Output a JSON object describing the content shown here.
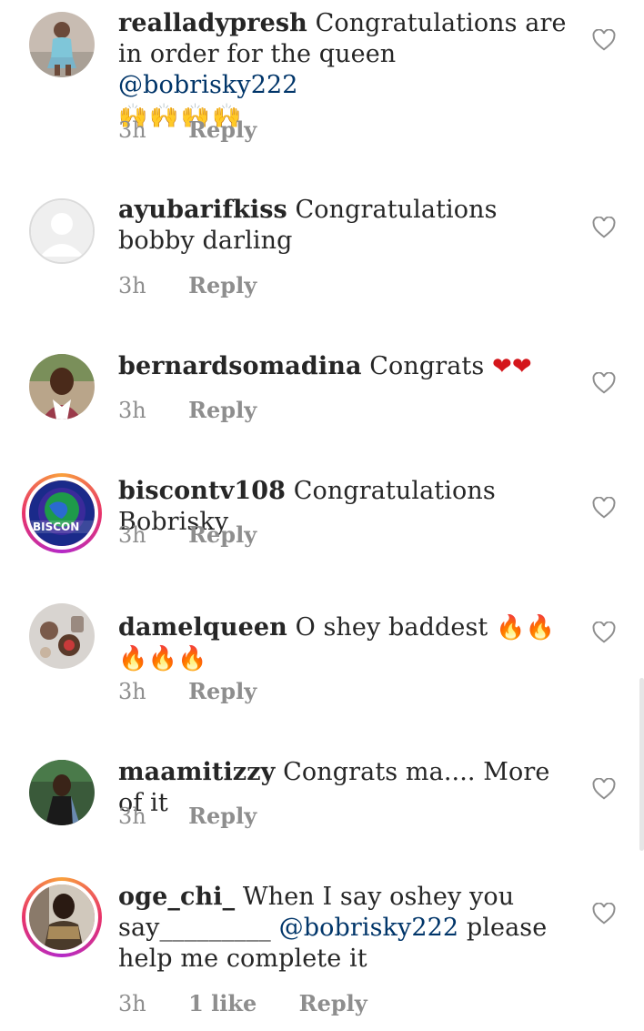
{
  "comments": [
    {
      "username": "realladypresh",
      "text": "Congratulations are in order for the queen",
      "mention": "@bobrisky222",
      "emoji": "🙌🙌🙌🙌",
      "time": "3h",
      "likes": "",
      "reply": "Reply"
    },
    {
      "username": "ayubarifkiss",
      "text": "Congratulations bobby darling",
      "time": "3h",
      "likes": "",
      "reply": "Reply"
    },
    {
      "username": "bernardsomadina",
      "text": "Congrats",
      "emoji": "❤❤",
      "time": "3h",
      "likes": "",
      "reply": "Reply"
    },
    {
      "username": "biscontv108",
      "text": "Congratulations Bobrisky",
      "avatar_text": "BISCON",
      "time": "3h",
      "likes": "",
      "reply": "Reply"
    },
    {
      "username": "damelqueen",
      "text": "O shey baddest",
      "emoji": "🔥🔥🔥🔥🔥",
      "time": "3h",
      "likes": "",
      "reply": "Reply"
    },
    {
      "username": "maamitizzy",
      "text": "Congrats ma.... More of it",
      "time": "3h",
      "likes": "",
      "reply": "Reply"
    },
    {
      "username": "oge_chi_",
      "text": "When I say oshey you say_________",
      "mention": "@bobrisky222",
      "text_after": "please help me complete it",
      "time": "3h",
      "likes": "1 like",
      "reply": "Reply"
    }
  ],
  "icons": {
    "like": "heart-outline-icon"
  },
  "colors": {
    "text": "#262626",
    "meta": "#8e8e8e",
    "mention": "#003569",
    "story_ring": "#e8336a"
  }
}
